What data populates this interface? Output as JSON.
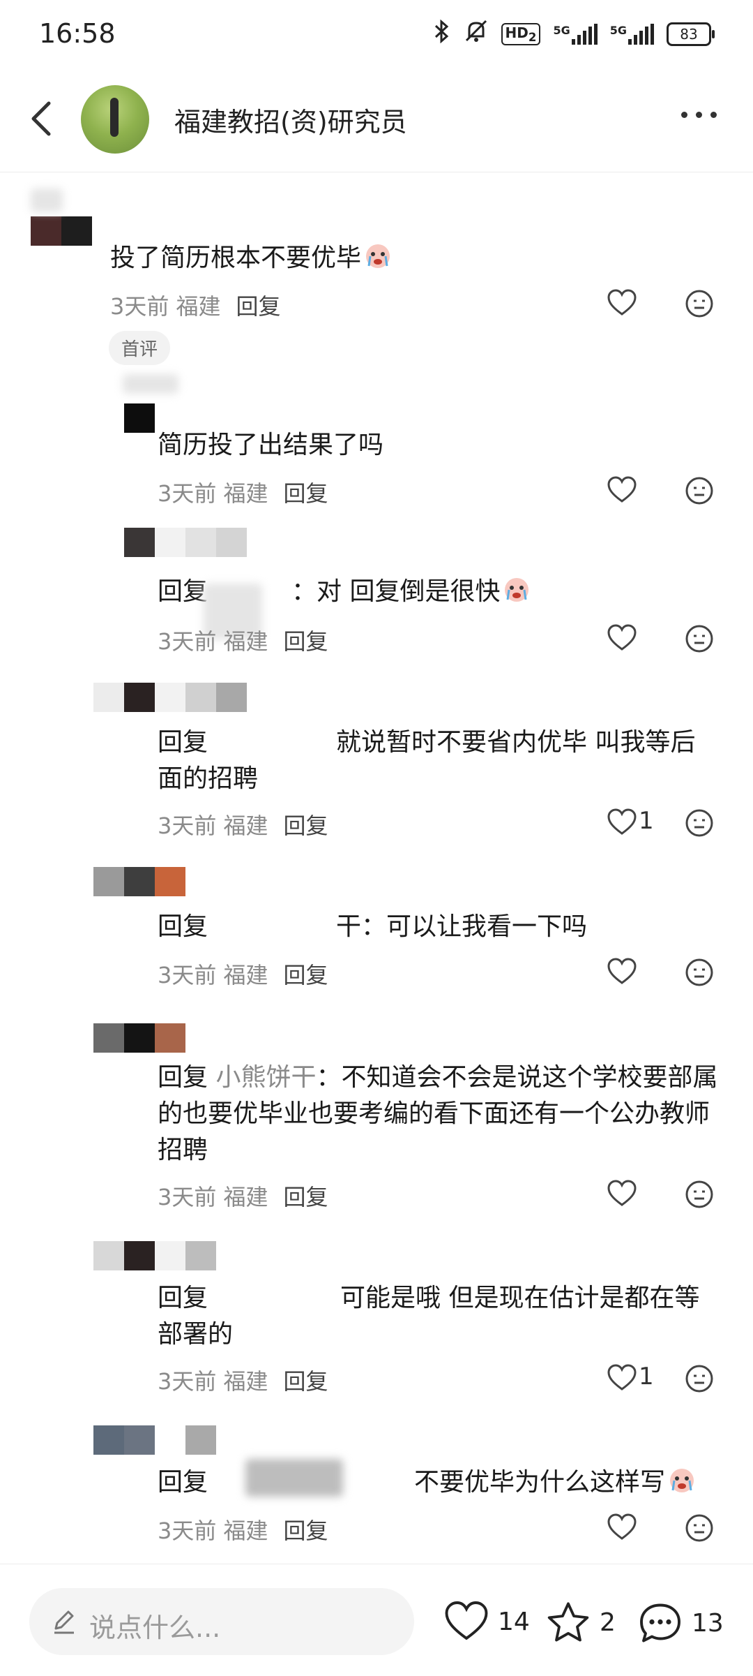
{
  "status_bar": {
    "time": "16:58",
    "hd": "HD",
    "hd_sub": "2",
    "net1": "5G",
    "net2": "5G",
    "battery": "83"
  },
  "header": {
    "title": "福建教招(资)研究员"
  },
  "comments": [
    {
      "text": "投了简历根本不要优毕",
      "meta": "3天前 福建",
      "reply": "回复",
      "badge": "首评",
      "likes": ""
    },
    {
      "text": "简历投了出结果了吗",
      "meta": "3天前 福建",
      "reply": "回复",
      "likes": ""
    },
    {
      "prefix": "回复",
      "name": "",
      "text": "：对 回复倒是很快",
      "meta": "3天前 福建",
      "reply": "回复",
      "likes": ""
    },
    {
      "prefix": "回复",
      "name": "",
      "text": "就说暂时不要省内优毕 叫我等后面的招聘",
      "meta": "3天前 福建",
      "reply": "回复",
      "likes": "1"
    },
    {
      "prefix": "回复",
      "name": "",
      "text": "干：可以让我看一下吗",
      "meta": "3天前 福建",
      "reply": "回复",
      "likes": ""
    },
    {
      "prefix": "回复",
      "name": "小熊饼干",
      "text": "：不知道会不会是说这个学校要部属的也要优毕业也要考编的看下面还有一个公办教师招聘",
      "meta": "3天前 福建",
      "reply": "回复",
      "likes": ""
    },
    {
      "prefix": "回复",
      "name": "",
      "text": "可能是哦 但是现在估计是都在等部署的",
      "meta": "3天前 福建",
      "reply": "回复",
      "likes": "1"
    },
    {
      "prefix": "回复",
      "name": "",
      "text": "不要优毕为什么这样写",
      "meta": "3天前 福建",
      "reply": "回复",
      "likes": ""
    }
  ],
  "bottom_bar": {
    "placeholder": "说点什么...",
    "likes": "14",
    "stars": "2",
    "comments": "13"
  },
  "colors": {
    "text": "#1a1a1a",
    "muted": "#8a8a8a",
    "background": "#ffffff"
  }
}
